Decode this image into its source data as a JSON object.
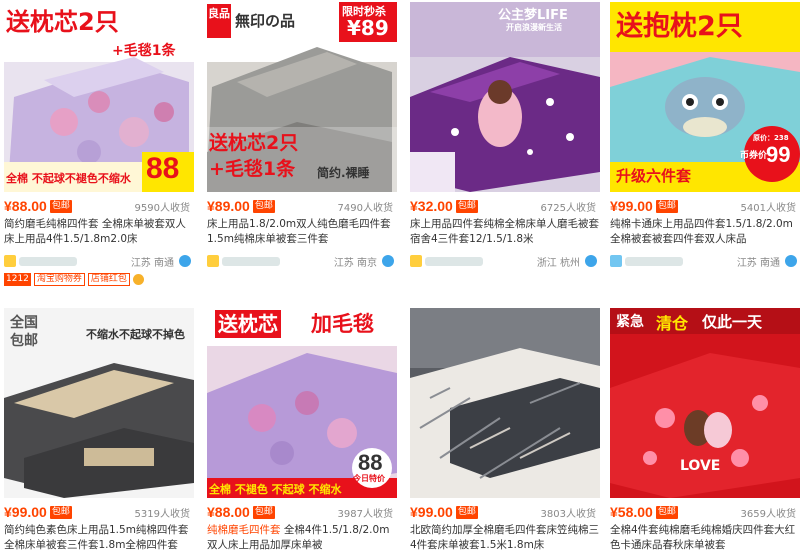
{
  "products": [
    {
      "banner_top": "送枕芯2只",
      "banner_sub": "+毛毯1条",
      "banner_bottom": "全棉 不起球不褪色不缩水",
      "banner_num": "88",
      "price": "¥88.00",
      "baoyou": "包邮",
      "sales": "9590人收货",
      "title": "简约磨毛纯棉四件套 全棉床单被套双人床上用品4件1.5/1.8m2.0床",
      "location": "江苏 南通",
      "tags": [
        "1212",
        "淘宝购物券",
        "店铺红包"
      ]
    },
    {
      "banner_badge": "良品",
      "banner_top": "無印の品",
      "banner_flash": "限时秒杀",
      "banner_flash_price": "¥89",
      "banner_mid": "送枕芯2只",
      "banner_mid2": "+毛毯1条",
      "banner_slogan": "简约.裸睡",
      "price": "¥89.00",
      "baoyou": "包邮",
      "sales": "7490人收货",
      "title": "床上用品1.8/2.0m双人纯色磨毛四件套1.5m纯棉床单被套三件套",
      "location": "江苏 南京"
    },
    {
      "banner_top": "公主梦LIFE",
      "banner_sub": "开启浪漫新生活",
      "price": "¥32.00",
      "baoyou": "包邮",
      "sales": "6725人收货",
      "title": "床上用品四件套纯棉全棉床单人磨毛被套宿舍4三件套12/1.5/1.8米",
      "location": "浙江 杭州"
    },
    {
      "banner_top": "送抱枕2只",
      "banner_bottom": "升级六件套",
      "banner_price_label": "币券价",
      "banner_price": "99",
      "banner_small": "原价：238",
      "price": "¥99.00",
      "baoyou": "包邮",
      "sales": "5401人收货",
      "title": "纯棉卡通床上用品四件套1.5/1.8/2.0m全棉被套被套四件套双人床品",
      "location": "江苏 南通"
    },
    {
      "banner_badge": "全国包邮",
      "banner_top": "不缩水不起球不掉色",
      "price": "¥99.00",
      "baoyou": "包邮",
      "sales": "5319人收货",
      "title": "简约纯色素色床上用品1.5m纯棉四件套全棉床单被套三件套1.8m全棉四件套",
      "location": ""
    },
    {
      "banner_top": "送枕芯",
      "banner_top2": "加毛毯",
      "banner_bottom": "全棉 不褪色 不起球 不缩水",
      "banner_num": "88",
      "banner_num_label": "今日特价",
      "price": "¥88.00",
      "baoyou": "包邮",
      "sales": "3987人收货",
      "title_hl": "纯棉磨毛四件套",
      "title": " 全棉4件1.5/1.8/2.0m双人床上用品加厚床单被",
      "location": ""
    },
    {
      "price": "¥99.00",
      "baoyou": "包邮",
      "sales": "3803人收货",
      "title": "北欧简约加厚全棉磨毛四件套床笠纯棉三4件套床单被套1.5米1.8m床",
      "location": ""
    },
    {
      "banner_left": "紧急",
      "banner_mid": "清仓",
      "banner_right": "仅此一天",
      "banner_love": "LOVE",
      "price": "¥58.00",
      "baoyou": "包邮",
      "sales": "3659人收货",
      "title": "全棉4件套纯棉磨毛纯棉婚庆四件套大红色卡通床品春秋床单被套",
      "location": ""
    }
  ],
  "colors": {
    "accent": "#ff4400",
    "yellow": "#ffe600",
    "purple_bed": "#9a86c8",
    "grey_bed": "#8c8c8c",
    "violet_bed": "#6b2a86",
    "red_bed": "#d2141c"
  }
}
